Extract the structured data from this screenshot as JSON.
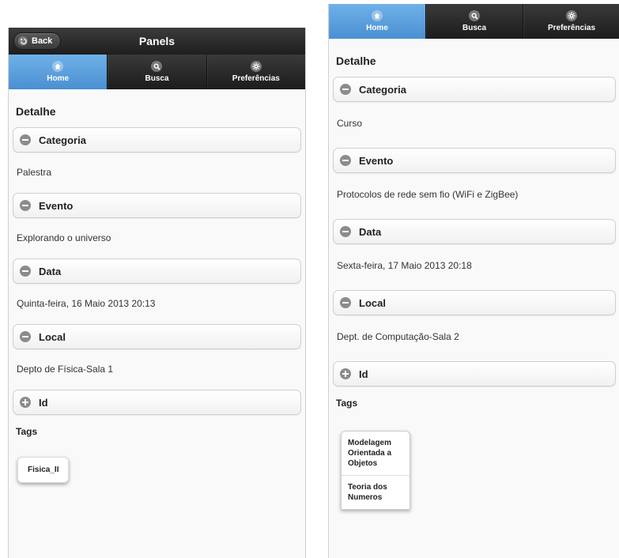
{
  "left": {
    "header": {
      "back_label": "Back",
      "title": "Panels"
    },
    "navbar": [
      {
        "label": "Home",
        "icon": "home-icon",
        "active": true
      },
      {
        "label": "Busca",
        "icon": "search-icon",
        "active": false
      },
      {
        "label": "Preferências",
        "icon": "gear-icon",
        "active": false
      }
    ],
    "heading": "Detalhe",
    "sections": [
      {
        "label": "Categoria",
        "state": "expanded",
        "value": "Palestra"
      },
      {
        "label": "Evento",
        "state": "expanded",
        "value": "Explorando o universo"
      },
      {
        "label": "Data",
        "state": "expanded",
        "value": "Quinta-feira, 16 Maio 2013 20:13"
      },
      {
        "label": "Local",
        "state": "expanded",
        "value": "Depto de Física-Sala 1"
      },
      {
        "label": "Id",
        "state": "collapsed"
      }
    ],
    "tags_label": "Tags",
    "tags": [
      "Fisica_II"
    ]
  },
  "right": {
    "navbar": [
      {
        "label": "Home",
        "icon": "home-icon",
        "active": true
      },
      {
        "label": "Busca",
        "icon": "search-icon",
        "active": false
      },
      {
        "label": "Preferências",
        "icon": "gear-icon",
        "active": false
      }
    ],
    "heading": "Detalhe",
    "sections": [
      {
        "label": "Categoria",
        "state": "expanded",
        "value": "Curso"
      },
      {
        "label": "Evento",
        "state": "expanded",
        "value": "Protocolos de rede sem fio (WiFi e ZigBee)"
      },
      {
        "label": "Data",
        "state": "expanded",
        "value": "Sexta-feira, 17 Maio 2013 20:18"
      },
      {
        "label": "Local",
        "state": "expanded",
        "value": "Dept. de Computação-Sala 2"
      },
      {
        "label": "Id",
        "state": "collapsed"
      }
    ],
    "tags_label": "Tags",
    "tags": [
      "Modelagem Orientada a Objetos",
      "Teoria dos Numeros"
    ]
  },
  "colors": {
    "active_tab": "#5a9fdc",
    "toolbar": "#2a2a2a",
    "collapsible_icon": "#8c8c8c"
  }
}
